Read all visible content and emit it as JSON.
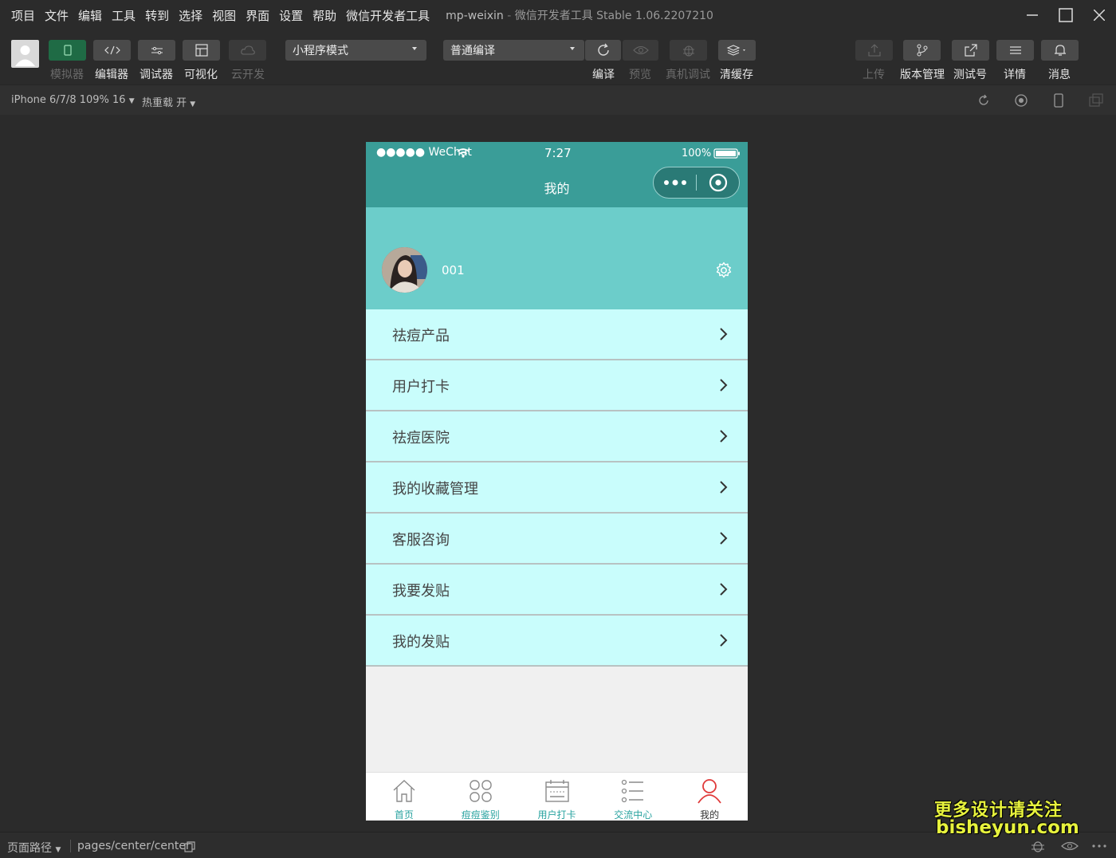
{
  "menubar": {
    "items": [
      "项目",
      "文件",
      "编辑",
      "工具",
      "转到",
      "选择",
      "视图",
      "界面",
      "设置",
      "帮助",
      "微信开发者工具"
    ],
    "project": "mp-weixin",
    "separator": "-",
    "app_version": "微信开发者工具 Stable 1.06.2207210"
  },
  "toolbar": {
    "simulator": "模拟器",
    "editor": "编辑器",
    "debugger": "调试器",
    "visual": "可视化",
    "cloud": "云开发",
    "mode_select": "小程序模式",
    "compile_select": "普通编译",
    "compile": "编译",
    "preview": "预览",
    "remote_debug": "真机调试",
    "clear_cache": "清缓存",
    "upload": "上传",
    "version_mgmt": "版本管理",
    "test_account": "测试号",
    "details": "详情",
    "messages": "消息"
  },
  "subbar": {
    "device": "iPhone 6/7/8 109% 16",
    "hot_reload": "热重载 开"
  },
  "phone": {
    "status": {
      "carrier": "●●●●● WeChat",
      "time": "7:27",
      "battery": "100%"
    },
    "nav_title": "我的",
    "profile": {
      "name": "001"
    },
    "menu": [
      {
        "label": "祛痘产品"
      },
      {
        "label": "用户打卡"
      },
      {
        "label": "祛痘医院"
      },
      {
        "label": "我的收藏管理"
      },
      {
        "label": "客服咨询"
      },
      {
        "label": "我要发贴"
      },
      {
        "label": "我的发贴"
      }
    ],
    "tabs": [
      {
        "label": "首页",
        "icon": "home-icon"
      },
      {
        "label": "痘痘鉴别",
        "icon": "grid-icon"
      },
      {
        "label": "用户打卡",
        "icon": "calendar-icon"
      },
      {
        "label": "交流中心",
        "icon": "list-icon"
      },
      {
        "label": "我的",
        "icon": "user-icon"
      }
    ],
    "accent": "#3a9d98",
    "list_bg": "#c9fdfc"
  },
  "footer": {
    "page_path_label": "页面路径",
    "page_path": "pages/center/center"
  },
  "watermark": {
    "line1": "更多设计请关注",
    "line2": "bisheyun.com"
  }
}
